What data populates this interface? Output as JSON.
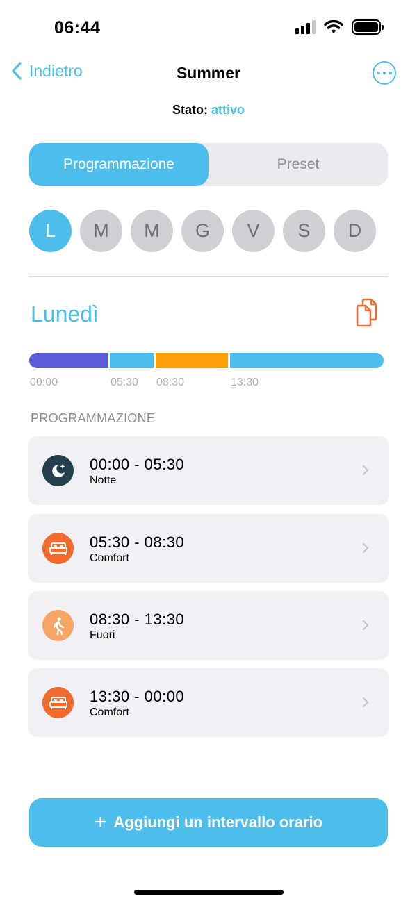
{
  "status_bar": {
    "time": "06:44",
    "icons": [
      "signal-icon",
      "wifi-icon",
      "battery-icon"
    ]
  },
  "nav": {
    "back_label": "Indietro",
    "title": "Summer",
    "more_icon": "ellipsis-circle-icon"
  },
  "state": {
    "label": "Stato:",
    "value": "attivo"
  },
  "tabs": [
    {
      "label": "Programmazione",
      "active": true
    },
    {
      "label": "Preset",
      "active": false
    }
  ],
  "days": [
    {
      "label": "L",
      "selected": true
    },
    {
      "label": "M",
      "selected": false
    },
    {
      "label": "M",
      "selected": false
    },
    {
      "label": "G",
      "selected": false
    },
    {
      "label": "V",
      "selected": false
    },
    {
      "label": "S",
      "selected": false
    },
    {
      "label": "D",
      "selected": false
    }
  ],
  "day_title": "Lunedì",
  "timeline": {
    "segments": [
      {
        "start": "00:00",
        "end": "05:30",
        "color": "#5b5bd6"
      },
      {
        "start": "05:30",
        "end": "08:30",
        "color": "#4dbdec"
      },
      {
        "start": "08:30",
        "end": "13:30",
        "color": "#ff9f0a"
      },
      {
        "start": "13:30",
        "end": "00:00",
        "color": "#4dbdec"
      }
    ],
    "ticks": [
      "00:00",
      "05:30",
      "08:30",
      "13:30"
    ]
  },
  "section_label": "PROGRAMMAZIONE",
  "intervals": [
    {
      "time": "00:00 - 05:30",
      "name": "Notte",
      "icon": "moon-stars-icon",
      "icon_bg": "#27404d"
    },
    {
      "time": "05:30 - 08:30",
      "name": "Comfort",
      "icon": "bed-icon",
      "icon_bg": "#f26a2e"
    },
    {
      "time": "08:30 - 13:30",
      "name": "Fuori",
      "icon": "walking-person-icon",
      "icon_bg": "#f4a566"
    },
    {
      "time": "13:30 - 00:00",
      "name": "Comfort",
      "icon": "bed-icon",
      "icon_bg": "#f26a2e"
    }
  ],
  "add_button": {
    "icon": "+",
    "label": "Aggiungi un intervallo orario"
  },
  "colors": {
    "accent": "#4dbdec",
    "copy_icon": "#f26a2e"
  }
}
